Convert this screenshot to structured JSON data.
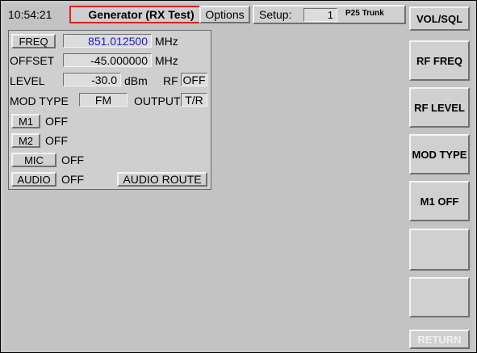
{
  "header": {
    "time": "10:54:21",
    "mode": "Generator (RX Test)",
    "options_label": "Options",
    "setup_label": "Setup:",
    "setup_value": "1",
    "setup_system": "P25 Trunk"
  },
  "panel": {
    "freq_label": "FREQ",
    "freq_value": "851.012500",
    "freq_unit": "MHz",
    "offset_label": "OFFSET",
    "offset_value": "-45.000000",
    "offset_unit": "MHz",
    "level_label": "LEVEL",
    "level_value": "-30.0",
    "level_unit": "dBm",
    "rf_label": "RF",
    "rf_value": "OFF",
    "modtype_label": "MOD TYPE",
    "modtype_value": "FM",
    "output_label": "OUTPUT",
    "output_value": "T/R",
    "m1_label": "M1",
    "m1_value": "OFF",
    "m2_label": "M2",
    "m2_value": "OFF",
    "mic_label": "MIC",
    "mic_value": "OFF",
    "audio_label": "AUDIO",
    "audio_value": "OFF",
    "audio_route_label": "AUDIO ROUTE"
  },
  "softkeys": [
    {
      "label": "VOL/SQL"
    },
    {
      "label": "RF FREQ"
    },
    {
      "label": "RF LEVEL"
    },
    {
      "label": "MOD TYPE"
    },
    {
      "label": "M1 OFF"
    },
    {
      "label": ""
    },
    {
      "label": ""
    },
    {
      "label": "RETURN"
    }
  ],
  "colors": {
    "background": "#c3c3c3",
    "freq_value": "#2020b0",
    "mode_border": "#e02020",
    "disabled_text": "#f0f0f0"
  }
}
